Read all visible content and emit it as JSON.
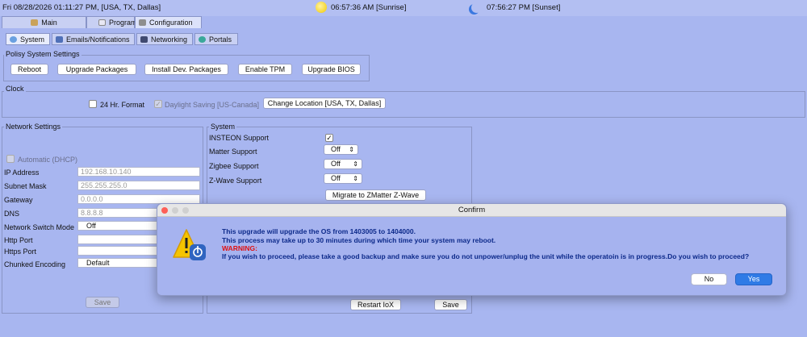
{
  "topbar": {
    "datetime": "Fri 08/28/2026 01:11:27 PM,  [USA, TX, Dallas]",
    "sunrise": "06:57:36 AM [Sunrise]",
    "sunset": "07:56:27 PM [Sunset]",
    "sunrise_icon": "sun-icon",
    "sunset_icon": "moon-icon"
  },
  "main_tabs": [
    "Main",
    "Programs",
    "Configuration"
  ],
  "sub_tabs": [
    "System",
    "Emails/Notifications",
    "Networking",
    "Portals"
  ],
  "polisy": {
    "title": "Polisy System Settings",
    "buttons": [
      "Reboot",
      "Upgrade Packages",
      "Install Dev. Packages",
      "Enable TPM",
      "Upgrade BIOS"
    ]
  },
  "clock": {
    "title": "Clock",
    "hr24_label": "24 Hr. Format",
    "daylight_label": "Daylight Saving [US-Canada]",
    "change_location": "Change Location [USA, TX, Dallas]"
  },
  "network": {
    "title": "Network Settings",
    "dhcp_label": "Automatic (DHCP)",
    "ip_label": "IP Address",
    "ip_value": "192.168.10.140",
    "subnet_label": "Subnet Mask",
    "subnet_value": "255.255.255.0",
    "gateway_label": "Gateway",
    "gateway_value": "0.0.0.0",
    "dns_label": "DNS",
    "dns_value": "8.8.8.8",
    "switch_label": "Network Switch Mode",
    "switch_value": "Off",
    "http_label": "Http Port",
    "https_label": "Https Port",
    "chunked_label": "Chunked Encoding",
    "chunked_value": "Default",
    "save": "Save"
  },
  "system": {
    "title": "System",
    "insteon_label": "INSTEON Support",
    "insteon_checked": "✓",
    "matter_label": "Matter Support",
    "matter_value": "Off",
    "zigbee_label": "Zigbee Support",
    "zigbee_value": "Off",
    "zwave_label": "Z-Wave Support",
    "zwave_value": "Off",
    "migrate": "Migrate to ZMatter Z-Wave",
    "restart": "Restart IoX",
    "save": "Save"
  },
  "dialog": {
    "title": "Confirm",
    "line1": "This upgrade will upgrade the OS from 1403005 to 1404000.",
    "line2": "This process may take up to 30 minutes during which time your system may reboot.",
    "warning": "WARNING:",
    "line3": "If you wish to proceed, please take a good backup and make sure you do not unpower/unplug the unit while the operatoin is in progress.Do you wish to proceed?",
    "no": "No",
    "yes": "Yes",
    "icon": "warning-icon",
    "colors": {
      "close": "#fe5f57",
      "minimize": "#d0d0d0",
      "zoom": "#d0d0d0",
      "warning_text": "#e01010",
      "yes_button": "#2f7be6"
    }
  }
}
